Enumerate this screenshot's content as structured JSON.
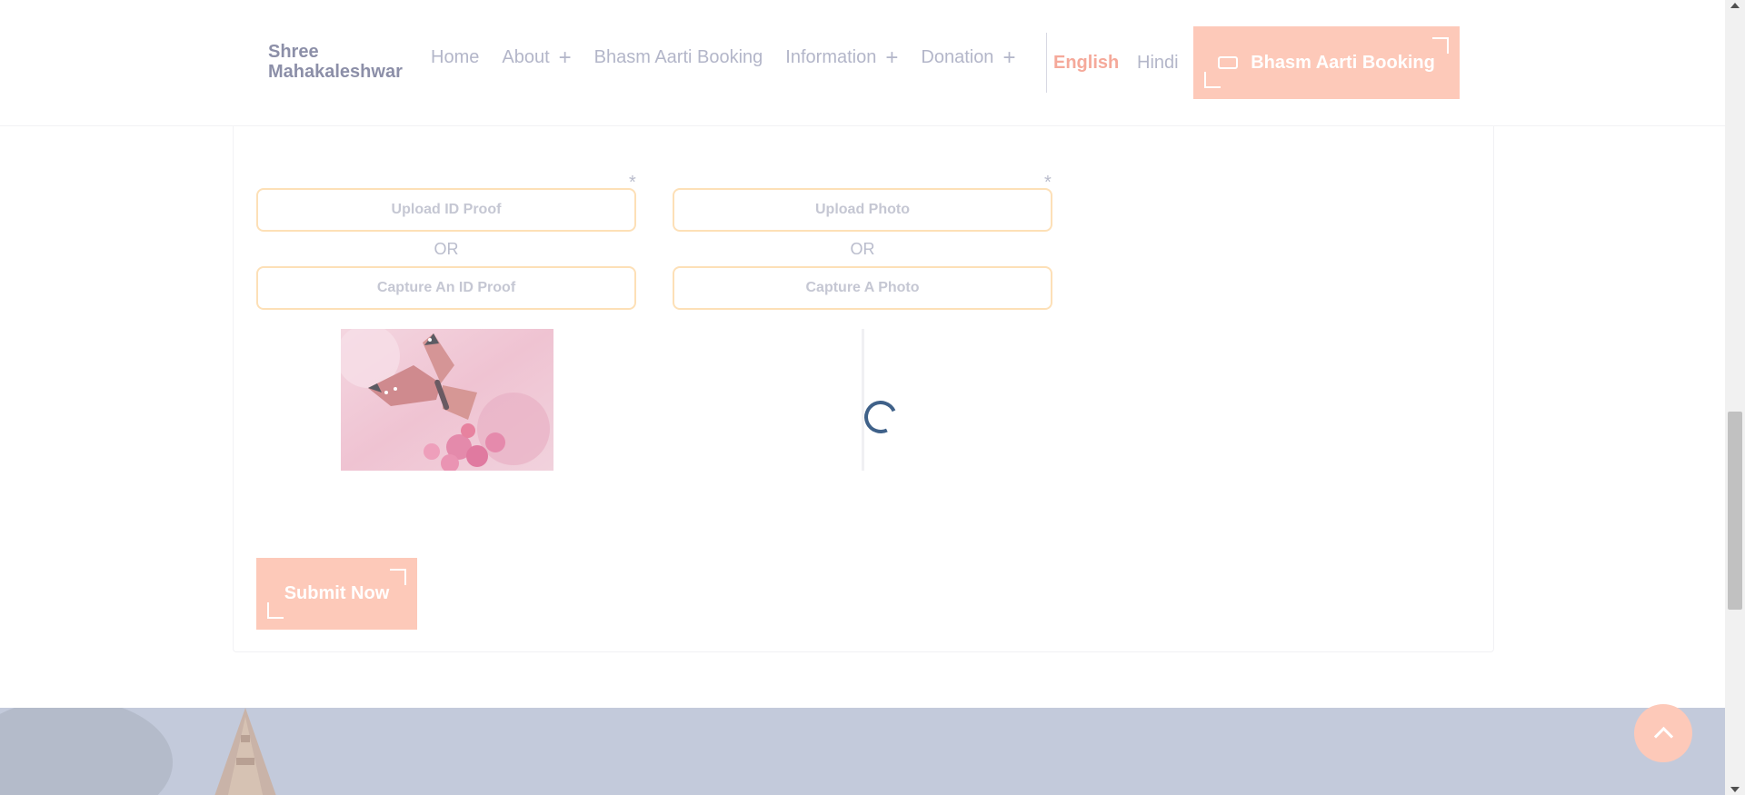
{
  "header": {
    "logo_line1": "Shree",
    "logo_line2": "Mahakaleshwar",
    "nav": [
      {
        "label": "Home"
      },
      {
        "label": "About",
        "has_plus": true
      },
      {
        "label": "Bhasm Aarti Booking"
      },
      {
        "label": "Information",
        "has_plus": true
      },
      {
        "label": "Donation",
        "has_plus": true
      }
    ],
    "plus_symbol": "+",
    "lang_english": "English",
    "lang_hindi": "Hindi",
    "cta_label": "Bhasm Aarti Booking"
  },
  "form": {
    "required_mark": "*",
    "upload_id_label": "Upload ID Proof",
    "or_text": "OR",
    "capture_id_label": "Capture An ID Proof",
    "upload_photo_label": "Upload Photo",
    "capture_photo_label": "Capture A Photo",
    "submit_label": "Submit Now"
  },
  "icons": {
    "ticket": "ticket-icon",
    "scroll_top": "chevron-up-icon",
    "loading": "loading-spinner-icon"
  },
  "colors": {
    "accent": "#fdc9b9",
    "active_lang": "#f5a99a",
    "input_border": "#fde0b7",
    "spinner": "#3f6189"
  }
}
